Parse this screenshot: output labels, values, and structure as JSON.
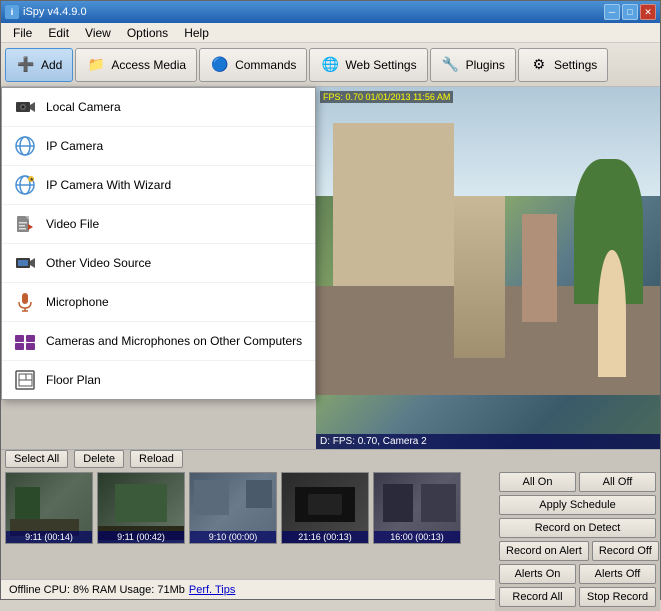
{
  "window": {
    "title": "iSpy v4.4.9.0",
    "title_icon": "i"
  },
  "title_buttons": {
    "minimize": "─",
    "maximize": "□",
    "close": "✕"
  },
  "menu": {
    "items": [
      "File",
      "Edit",
      "View",
      "Options",
      "Help"
    ]
  },
  "toolbar": {
    "buttons": [
      {
        "id": "add",
        "label": "Add",
        "icon": "➕"
      },
      {
        "id": "access-media",
        "label": "Access Media",
        "icon": "📁"
      },
      {
        "id": "commands",
        "label": "Commands",
        "icon": "🔵"
      },
      {
        "id": "web-settings",
        "label": "Web Settings",
        "icon": "🌐"
      },
      {
        "id": "plugins",
        "label": "Plugins",
        "icon": "🔧"
      },
      {
        "id": "settings",
        "label": "Settings",
        "icon": "⚙"
      }
    ]
  },
  "dropdown": {
    "items": [
      {
        "id": "local-camera",
        "label": "Local Camera",
        "icon": "camera"
      },
      {
        "id": "ip-camera",
        "label": "IP Camera",
        "icon": "globe"
      },
      {
        "id": "ip-camera-wizard",
        "label": "IP Camera With Wizard",
        "icon": "globe-star"
      },
      {
        "id": "video-file",
        "label": "Video File",
        "icon": "file"
      },
      {
        "id": "other-video",
        "label": "Other Video Source",
        "icon": "video"
      },
      {
        "id": "microphone",
        "label": "Microphone",
        "icon": "mic"
      },
      {
        "id": "cameras-other",
        "label": "Cameras and Microphones on Other Computers",
        "icon": "network"
      },
      {
        "id": "floor-plan",
        "label": "Floor Plan",
        "icon": "floor"
      }
    ]
  },
  "camera": {
    "overlay_top": "FPS: 0.70 01/01/2013 11:56 AM",
    "overlay_bottom": "D: FPS: 0.70, Camera 2"
  },
  "bottom_toolbar": {
    "select_all": "Select All",
    "delete": "Delete",
    "reload": "Reload"
  },
  "thumbnails": [
    {
      "label": "9:11 (00:14)",
      "class": "thumb1"
    },
    {
      "label": "9:11 (00:42)",
      "class": "thumb2"
    },
    {
      "label": "9:10 (00:00)",
      "class": "thumb3"
    },
    {
      "label": "21:16 (00:13)",
      "class": "thumb4"
    },
    {
      "label": "16:00 (00:13)",
      "class": "thumb5"
    }
  ],
  "controls": {
    "rows": [
      [
        {
          "label": "All On",
          "id": "all-on"
        },
        {
          "label": "All Off",
          "id": "all-off"
        }
      ],
      [
        {
          "label": "Apply Schedule",
          "id": "apply-schedule"
        }
      ],
      [
        {
          "label": "Record on Detect",
          "id": "record-on-detect"
        }
      ],
      [
        {
          "label": "Record on Alert",
          "id": "record-on-alert"
        },
        {
          "label": "Record Off",
          "id": "record-off"
        }
      ],
      [
        {
          "label": "Alerts On",
          "id": "alerts-on"
        },
        {
          "label": "Alerts Off",
          "id": "alerts-off"
        }
      ],
      [
        {
          "label": "Record All",
          "id": "record-all"
        },
        {
          "label": "Stop Record",
          "id": "stop-record"
        }
      ]
    ]
  },
  "status": {
    "text": "Offline  CPU: 8% RAM Usage: 71Mb",
    "link": "Perf. Tips",
    "right": "..."
  }
}
